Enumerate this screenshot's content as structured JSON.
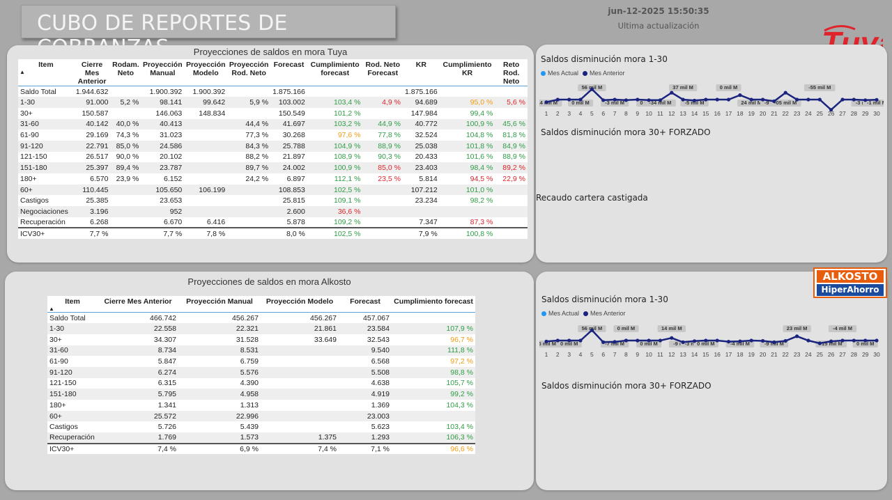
{
  "header": {
    "title": "CUBO DE REPORTES DE COBRANZAS",
    "timestamp": "jun-12-2025 15:50:35",
    "timestamp_label": "Ultima actualización"
  },
  "logos": {
    "tuya": "Tuya",
    "alkosto_top": "ALKOSTO",
    "alkosto_bottom": "HiperAhorro"
  },
  "tuya_table": {
    "title": "Proyecciones de saldos en mora Tuya",
    "columns": [
      "Item",
      "Cierre Mes Anterior",
      "Rodam. Neto",
      "Proyección Manual",
      "Proyección Modelo",
      "Proyección Rod. Neto",
      "Forecast",
      "Cumplimiento forecast",
      "Rod. Neto Forecast",
      "KR",
      "Cumplimiento KR",
      "Reto Rod. Neto"
    ],
    "rows": [
      {
        "cells": [
          "Saldo Total",
          "1.944.632",
          "",
          "1.900.392",
          "1.900.392",
          "",
          "1.875.166",
          "",
          "",
          "1.875.166",
          "",
          ""
        ],
        "colors": [
          "",
          "",
          "",
          "",
          "",
          "",
          "",
          "",
          "",
          "",
          "",
          ""
        ]
      },
      {
        "cells": [
          "1-30",
          "91.000",
          "5,2 %",
          "98.141",
          "99.642",
          "5,9 %",
          "103.002",
          "103,4 %",
          "4,9 %",
          "94.689",
          "95,0 %",
          "5,6 %"
        ],
        "colors": [
          "",
          "",
          "",
          "",
          "",
          "",
          "",
          "green",
          "red",
          "",
          "orange",
          "red"
        ]
      },
      {
        "cells": [
          "30+",
          "150.587",
          "",
          "146.063",
          "148.834",
          "",
          "150.549",
          "101,2 %",
          "",
          "147.984",
          "99,4 %",
          ""
        ],
        "colors": [
          "",
          "",
          "",
          "",
          "",
          "",
          "",
          "green",
          "",
          "",
          "green",
          ""
        ]
      },
      {
        "cells": [
          "31-60",
          "40.142",
          "40,0 %",
          "40.413",
          "",
          "44,4 %",
          "41.697",
          "103,2 %",
          "44,9 %",
          "40.772",
          "100,9 %",
          "45,6 %"
        ],
        "colors": [
          "",
          "",
          "",
          "",
          "",
          "",
          "",
          "green",
          "green",
          "",
          "green",
          "green"
        ]
      },
      {
        "cells": [
          "61-90",
          "29.169",
          "74,3 %",
          "31.023",
          "",
          "77,3 %",
          "30.268",
          "97,6 %",
          "77,8 %",
          "32.524",
          "104,8 %",
          "81,8 %"
        ],
        "colors": [
          "",
          "",
          "",
          "",
          "",
          "",
          "",
          "orange",
          "green",
          "",
          "green",
          "green"
        ]
      },
      {
        "cells": [
          "91-120",
          "22.791",
          "85,0 %",
          "24.586",
          "",
          "84,3 %",
          "25.788",
          "104,9 %",
          "88,9 %",
          "25.038",
          "101,8 %",
          "84,9 %"
        ],
        "colors": [
          "",
          "",
          "",
          "",
          "",
          "",
          "",
          "green",
          "green",
          "",
          "green",
          "green"
        ]
      },
      {
        "cells": [
          "121-150",
          "26.517",
          "90,0 %",
          "20.102",
          "",
          "88,2 %",
          "21.897",
          "108,9 %",
          "90,3 %",
          "20.433",
          "101,6 %",
          "88,9 %"
        ],
        "colors": [
          "",
          "",
          "",
          "",
          "",
          "",
          "",
          "green",
          "green",
          "",
          "green",
          "green"
        ]
      },
      {
        "cells": [
          "151-180",
          "25.397",
          "89,4 %",
          "23.787",
          "",
          "89,7 %",
          "24.002",
          "100,9 %",
          "85,0 %",
          "23.403",
          "98,4 %",
          "89,2 %"
        ],
        "colors": [
          "",
          "",
          "",
          "",
          "",
          "",
          "",
          "green",
          "red",
          "",
          "green",
          "red"
        ]
      },
      {
        "cells": [
          "180+",
          "6.570",
          "23,9 %",
          "6.152",
          "",
          "24,2 %",
          "6.897",
          "112,1 %",
          "23,5 %",
          "5.814",
          "94,5 %",
          "22,9 %"
        ],
        "colors": [
          "",
          "",
          "",
          "",
          "",
          "",
          "",
          "green",
          "red",
          "",
          "red",
          "red"
        ]
      },
      {
        "cells": [
          "60+",
          "110.445",
          "",
          "105.650",
          "106.199",
          "",
          "108.853",
          "102,5 %",
          "",
          "107.212",
          "101,0 %",
          ""
        ],
        "colors": [
          "",
          "",
          "",
          "",
          "",
          "",
          "",
          "green",
          "",
          "",
          "green",
          ""
        ]
      },
      {
        "cells": [
          "Castigos",
          "25.385",
          "",
          "23.653",
          "",
          "",
          "25.815",
          "109,1 %",
          "",
          "23.234",
          "98,2 %",
          ""
        ],
        "colors": [
          "",
          "",
          "",
          "",
          "",
          "",
          "",
          "green",
          "",
          "",
          "green",
          ""
        ]
      },
      {
        "cells": [
          "Negociaciones",
          "3.196",
          "",
          "952",
          "",
          "",
          "2.600",
          "36,6 %",
          "",
          "",
          "",
          ""
        ],
        "colors": [
          "",
          "",
          "",
          "",
          "",
          "",
          "",
          "red",
          "",
          "",
          "",
          ""
        ]
      },
      {
        "cells": [
          "Recuperación",
          "6.268",
          "",
          "6.670",
          "6.416",
          "",
          "5.878",
          "109,2 %",
          "",
          "7.347",
          "87,3 %",
          ""
        ],
        "colors": [
          "",
          "",
          "",
          "",
          "",
          "",
          "",
          "green",
          "",
          "",
          "red",
          ""
        ]
      }
    ],
    "total": {
      "cells": [
        "ICV30+",
        "7,7 %",
        "",
        "7,7 %",
        "7,8 %",
        "",
        "8,0 %",
        "102,5 %",
        "",
        "7,9 %",
        "100,8 %",
        ""
      ],
      "colors": [
        "",
        "",
        "",
        "",
        "",
        "",
        "",
        "green",
        "",
        "",
        "green",
        ""
      ]
    }
  },
  "alkosto_table": {
    "title": "Proyecciones de saldos en mora Alkosto",
    "columns": [
      "Item",
      "Cierre Mes Anterior",
      "Proyección Manual",
      "Proyección Modelo",
      "Forecast",
      "Cumplimiento forecast"
    ],
    "rows": [
      {
        "cells": [
          "Saldo Total",
          "466.742",
          "456.267",
          "456.267",
          "457.067",
          ""
        ],
        "colors": [
          "",
          "",
          "",
          "",
          "",
          ""
        ]
      },
      {
        "cells": [
          "1-30",
          "22.558",
          "22.321",
          "21.861",
          "23.584",
          "107,9 %"
        ],
        "colors": [
          "",
          "",
          "",
          "",
          "",
          "green"
        ]
      },
      {
        "cells": [
          "30+",
          "34.307",
          "31.528",
          "33.649",
          "32.543",
          "96,7 %"
        ],
        "colors": [
          "",
          "",
          "",
          "",
          "",
          "orange"
        ]
      },
      {
        "cells": [
          "31-60",
          "8.734",
          "8.531",
          "",
          "9.540",
          "111,8 %"
        ],
        "colors": [
          "",
          "",
          "",
          "",
          "",
          "green"
        ]
      },
      {
        "cells": [
          "61-90",
          "5.847",
          "6.759",
          "",
          "6.568",
          "97,2 %"
        ],
        "colors": [
          "",
          "",
          "",
          "",
          "",
          "orange"
        ]
      },
      {
        "cells": [
          "91-120",
          "6.274",
          "5.576",
          "",
          "5.508",
          "98,8 %"
        ],
        "colors": [
          "",
          "",
          "",
          "",
          "",
          "green"
        ]
      },
      {
        "cells": [
          "121-150",
          "6.315",
          "4.390",
          "",
          "4.638",
          "105,7 %"
        ],
        "colors": [
          "",
          "",
          "",
          "",
          "",
          "green"
        ]
      },
      {
        "cells": [
          "151-180",
          "5.795",
          "4.958",
          "",
          "4.919",
          "99,2 %"
        ],
        "colors": [
          "",
          "",
          "",
          "",
          "",
          "green"
        ]
      },
      {
        "cells": [
          "180+",
          "1.341",
          "1.313",
          "",
          "1.369",
          "104,3 %"
        ],
        "colors": [
          "",
          "",
          "",
          "",
          "",
          "green"
        ]
      },
      {
        "cells": [
          "60+",
          "25.572",
          "22.996",
          "",
          "23.003",
          ""
        ],
        "colors": [
          "",
          "",
          "",
          "",
          "",
          ""
        ]
      },
      {
        "cells": [
          "Castigos",
          "5.726",
          "5.439",
          "",
          "5.623",
          "103,4 %"
        ],
        "colors": [
          "",
          "",
          "",
          "",
          "",
          "green"
        ]
      },
      {
        "cells": [
          "Recuperación",
          "1.769",
          "1.573",
          "1.375",
          "1.293",
          "106,3 %"
        ],
        "colors": [
          "",
          "",
          "",
          "",
          "",
          "green"
        ]
      }
    ],
    "total": {
      "cells": [
        "ICV30+",
        "7,4 %",
        "6,9 %",
        "7,4 %",
        "7,1 %",
        "96,6 %"
      ],
      "colors": [
        "",
        "",
        "",
        "",
        "",
        "orange"
      ]
    }
  },
  "tuya_charts": {
    "chart1_title": "Saldos disminución mora 1-30",
    "chart2_title": "Saldos disminución mora 30+ FORZADO",
    "chart3_title": "Recaudo cartera castigada",
    "legend_actual": "Mes Actual",
    "legend_anterior": "Mes Anterior"
  },
  "alkosto_charts": {
    "chart1_title": "Saldos disminución mora 1-30",
    "chart2_title": "Saldos disminución mora 30+ FORZADO",
    "legend_actual": "Mes Actual",
    "legend_anterior": "Mes Anterior"
  },
  "colors": {
    "series_actual": "#2196f3",
    "series_anterior": "#1a237e",
    "positive": "#2e9c46",
    "warning": "#f39c12",
    "negative": "#e0242b"
  },
  "chart_data": [
    {
      "type": "line",
      "title": "Saldos disminución mora 1-30",
      "x": [
        1,
        2,
        3,
        4,
        5,
        6,
        7,
        8,
        9,
        10,
        11,
        12,
        13,
        14,
        15,
        16,
        17,
        18,
        19,
        20,
        21,
        22,
        23,
        24,
        25,
        26,
        27,
        28,
        29,
        30
      ],
      "series": [
        {
          "name": "Mes Anterior",
          "values": [
            -14,
            0,
            0,
            0,
            56,
            -3,
            0,
            -3,
            0,
            -3,
            -3,
            37,
            0,
            -5,
            0,
            0,
            0,
            24,
            0,
            0,
            -9,
            37,
            0,
            0,
            0,
            -55,
            0,
            0,
            -3,
            -1
          ]
        }
      ],
      "data_labels": [
        {
          "x": 1,
          "text": "-14 mil M"
        },
        {
          "x": 4,
          "text": "0 mil M"
        },
        {
          "x": 5,
          "text": "56 mil M"
        },
        {
          "x": 7,
          "text": "-3 mil M"
        },
        {
          "x": 10,
          "text": "0 mil M"
        },
        {
          "x": 11,
          "text": "-34 mil M"
        },
        {
          "x": 13,
          "text": "37 mil M"
        },
        {
          "x": 14,
          "text": "-5 mil M"
        },
        {
          "x": 17,
          "text": "0 mil M"
        },
        {
          "x": 19,
          "text": "24 mil M"
        },
        {
          "x": 21,
          "text": "-9 mil M"
        },
        {
          "x": 22,
          "text": "-05 mil M"
        },
        {
          "x": 25,
          "text": "-55 mil M"
        },
        {
          "x": 29,
          "text": "-3 mil M"
        },
        {
          "x": 30,
          "text": "-1 mil M"
        }
      ]
    },
    {
      "type": "line",
      "title": "Saldos disminución mora 1-30",
      "x": [
        1,
        2,
        3,
        4,
        5,
        6,
        7,
        8,
        9,
        10,
        11,
        12,
        13,
        14,
        15,
        16,
        17,
        18,
        19,
        20,
        21,
        22,
        23,
        24,
        25,
        26,
        27,
        28,
        29,
        30
      ],
      "series": [
        {
          "name": "Mes Anterior",
          "values": [
            -5,
            0,
            0,
            0,
            56,
            -9,
            -7,
            0,
            0,
            0,
            0,
            14,
            -9,
            -3,
            0,
            0,
            -6,
            -4,
            0,
            -2,
            -9,
            -2,
            23,
            0,
            -15,
            -4,
            0,
            0,
            0,
            0
          ]
        }
      ],
      "data_labels": [
        {
          "x": 1,
          "text": "-5 mil M"
        },
        {
          "x": 3,
          "text": "0 mil M"
        },
        {
          "x": 5,
          "text": "56 mil M"
        },
        {
          "x": 7,
          "text": "-7 mil M"
        },
        {
          "x": 8,
          "text": "0 mil M"
        },
        {
          "x": 10,
          "text": "0 mil M"
        },
        {
          "x": 12,
          "text": "14 mil M"
        },
        {
          "x": 13,
          "text": "-9 mil M"
        },
        {
          "x": 14,
          "text": "-3 mil M"
        },
        {
          "x": 15,
          "text": "0 mil M"
        },
        {
          "x": 18,
          "text": "-6 mil M"
        },
        {
          "x": 18,
          "text": "-4 mil M"
        },
        {
          "x": 21,
          "text": "-2 mil M"
        },
        {
          "x": 21,
          "text": "-9 mil M"
        },
        {
          "x": 23,
          "text": "23 mil M"
        },
        {
          "x": 26,
          "text": "-15 mil M"
        },
        {
          "x": 27,
          "text": "-4 mil M"
        },
        {
          "x": 29,
          "text": "0 mil M"
        }
      ]
    }
  ]
}
